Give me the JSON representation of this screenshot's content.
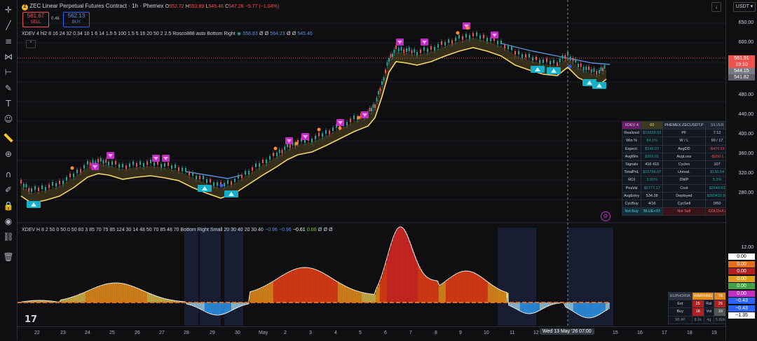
{
  "header": {
    "symbol_badge": "Z",
    "title": "ZEC Linear Perpetual Futures Contract · 1h · Phemex",
    "o_label": "O",
    "o": "552.72",
    "h_label": "H",
    "h": "553.89",
    "l_label": "L",
    "l": "545.46",
    "c_label": "C",
    "c": "547.26",
    "change": "−5.77 (−1.04%)",
    "sell_price": "561.67",
    "sell_label": "SELL",
    "spread": "0.46",
    "buy_price": "562.13",
    "buy_label": "BUY",
    "currency": "USDT"
  },
  "legend1": {
    "text": "XDEV 4 hl2 8 16 24 32 0.34 10 1 6 14 1.5 5 100 1.5 5 16 20 50 2 2.5 Rosco888 auto Bottom Right",
    "v1": "558.83",
    "v2": "564.23",
    "v3": "545.46",
    "empty_sym": "Ø"
  },
  "legend2": {
    "text": "XDEV H 8 2 50 0 50 0 50 60 3 85 70 75 85 124 30 14 48 50 70 85 48 70 Bottom Right Small 20 30 40 20 30 40",
    "v1": "−0.96",
    "v2": "−0.96",
    "v3": "−0.61",
    "v4": "0.00",
    "empty_sym": "Ø"
  },
  "price_axis": {
    "ticks": [
      "650.00",
      "600.00",
      "560.00",
      "520.00",
      "480.00",
      "440.00",
      "400.00",
      "360.00",
      "320.00",
      "280.00"
    ],
    "last_price": "561.91",
    "countdown": "19:10",
    "tag_a": "544.15",
    "tag_b": "541.82"
  },
  "osc_axis": {
    "ticks": [
      "12.00",
      "6.00",
      "−4.00"
    ],
    "tags": [
      "0.00",
      "0.00",
      "0.00",
      "0.00",
      "0.00",
      "0.00",
      "−0.43",
      "−0.43",
      "−1.35"
    ]
  },
  "time_axis": {
    "labels": [
      "22",
      "23",
      "24",
      "25",
      "26",
      "27",
      "28",
      "29",
      "30",
      "May",
      "2",
      "3",
      "4",
      "5",
      "6",
      "7",
      "8",
      "9",
      "10",
      "11",
      "12",
      "14",
      "15",
      "16",
      "17",
      "18",
      "19"
    ],
    "crosshair_label": "Wed 13 May '26   07:00"
  },
  "stats_table": {
    "header": [
      "XDEV 4",
      "60",
      "PHEMEX:ZECUSDT.P",
      "SILVER"
    ],
    "rows": [
      [
        "Realized",
        "$15629.53",
        "PF",
        "7.12"
      ],
      [
        "Win %",
        "84.1%",
        "W / L",
        "90 / 17"
      ],
      [
        "Expect.",
        "$146.07",
        "AvgDD",
        "-$470.51"
      ],
      [
        "AvgWin",
        "$202.01",
        "AvgLoss",
        "-$150.1"
      ],
      [
        "Signals",
        "416 415",
        "Cycles",
        "107"
      ],
      [
        "TotalPnL",
        "$15766.07",
        "Unreal.",
        "$136.54"
      ],
      [
        "ROI",
        "3.91%",
        "DWP",
        "5.2%"
      ],
      [
        "PosVal",
        "$2777.17",
        "Cost",
        "$2640.63"
      ],
      [
        "AvgEntry",
        "534.28",
        "Deployed",
        "$399432.86"
      ],
      [
        "CycBuy",
        "4/16",
        "CycSell",
        "0/50"
      ],
      [
        "Nxt Buy",
        "BLUE+X†",
        "Nxt Sell",
        "GOLD+X↓"
      ]
    ]
  },
  "osc_table": {
    "row1": [
      "EUPHORIA",
      "WARNING",
      "78"
    ],
    "row2": [
      "Ext",
      "25",
      "Ral",
      "25"
    ],
    "row3": [
      "Buy",
      "18",
      "Vol",
      "10"
    ],
    "row4": [
      "98.4P",
      "8.1k",
      "4g",
      "5.82k"
    ]
  },
  "colors": {
    "bg": "#0f0f12",
    "up": "#26a69a",
    "down": "#ef5350",
    "yellow_line": "#f5d76e",
    "blue_line": "#5b8ed8",
    "magenta": "#c030c0",
    "cyan": "#15b0c8"
  },
  "icons": [
    "cursor-icon",
    "trend-line-icon",
    "fib-icon",
    "pattern-icon",
    "measure-icon",
    "brush-icon",
    "text-icon",
    "emoji-icon",
    "ruler-icon",
    "zoom-icon",
    "magnet-icon",
    "lock-icon",
    "visibility-icon",
    "link-icon",
    "trash-icon"
  ]
}
